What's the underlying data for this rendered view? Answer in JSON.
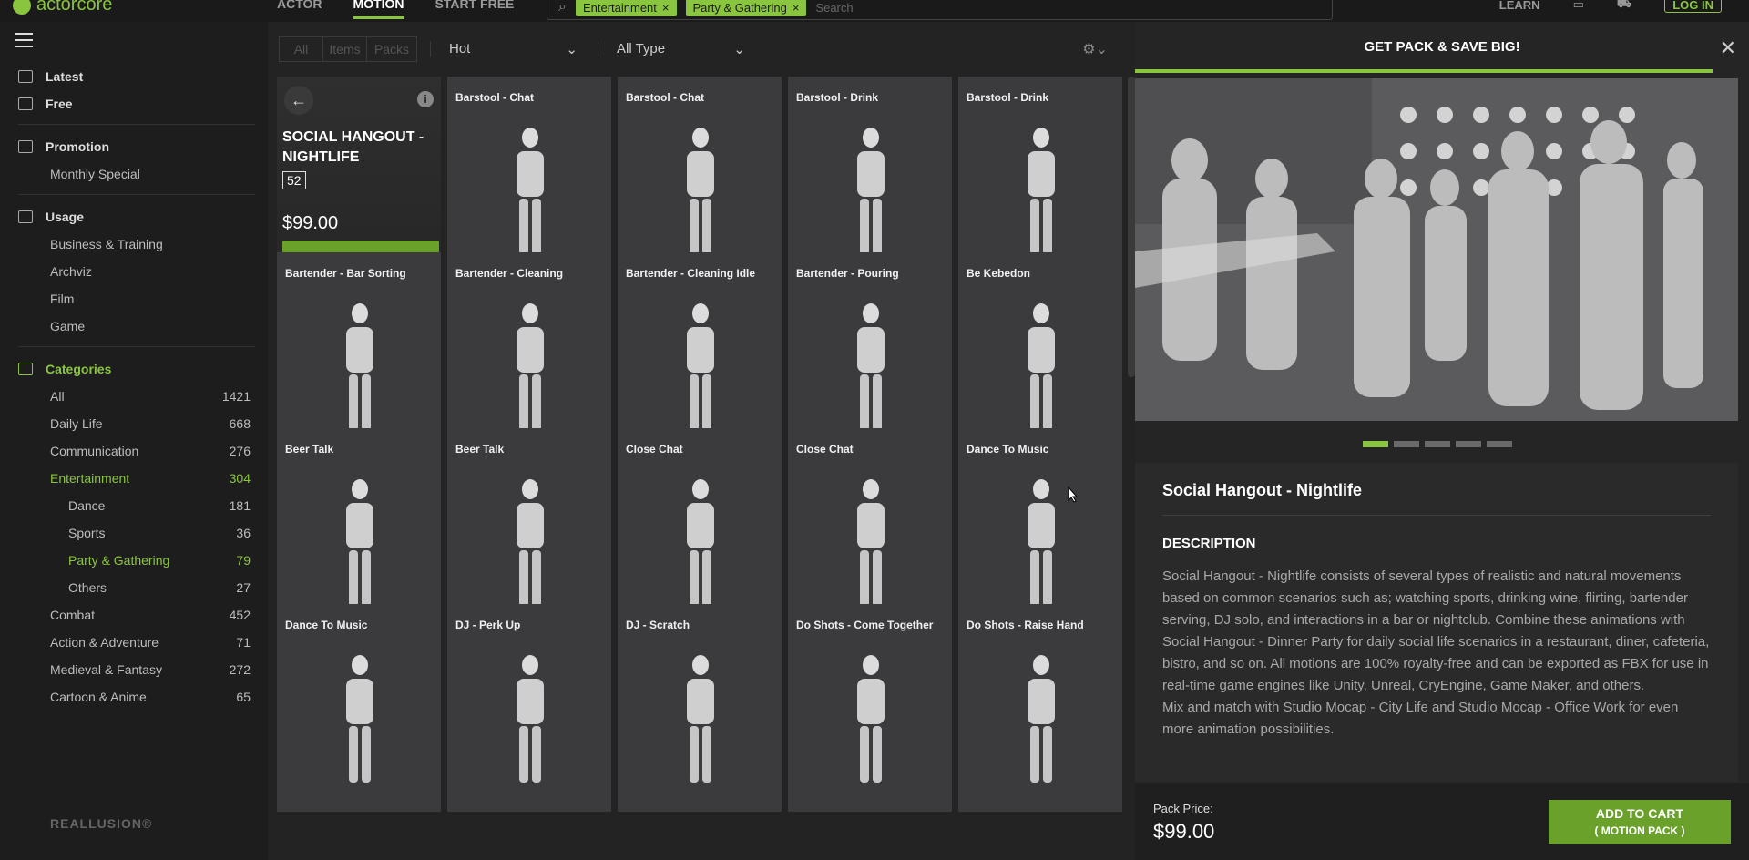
{
  "topbar": {
    "logo": "actorcore",
    "nav": [
      "ACTOR",
      "MOTION",
      "START FREE"
    ],
    "active_nav": "MOTION",
    "chips": [
      "Entertainment",
      "Party & Gathering"
    ],
    "search_placeholder": "Search",
    "learn": "LEARN",
    "login": "LOG IN"
  },
  "sidebar": {
    "latest": "Latest",
    "free": "Free",
    "promotion": "Promotion",
    "monthly_special": "Monthly Special",
    "usage": "Usage",
    "usage_items": [
      "Business & Training",
      "Archviz",
      "Film",
      "Game"
    ],
    "categories": "Categories",
    "cats": [
      {
        "label": "All",
        "count": "1421"
      },
      {
        "label": "Daily Life",
        "count": "668"
      },
      {
        "label": "Communication",
        "count": "276"
      },
      {
        "label": "Entertainment",
        "count": "304"
      },
      {
        "label": "Dance",
        "count": "181"
      },
      {
        "label": "Sports",
        "count": "36"
      },
      {
        "label": "Party & Gathering",
        "count": "79"
      },
      {
        "label": "Others",
        "count": "27"
      },
      {
        "label": "Combat",
        "count": "452"
      },
      {
        "label": "Action & Adventure",
        "count": "71"
      },
      {
        "label": "Medieval & Fantasy",
        "count": "272"
      },
      {
        "label": "Cartoon & Anime",
        "count": "65"
      }
    ],
    "brand": "REALLUSION®"
  },
  "filters": {
    "seg": [
      "All",
      "Items",
      "Packs"
    ],
    "sort": "Hot",
    "type": "All Type"
  },
  "pack": {
    "title": "SOCIAL HANGOUT - NIGHTLIFE",
    "count": "52",
    "price": "$99.00",
    "cart": "ADD TO CART"
  },
  "tiles": [
    "Barstool - Chat",
    "Barstool - Chat",
    "Barstool - Drink",
    "Barstool - Drink",
    "Bartender - Bar Sorting",
    "Bartender - Cleaning",
    "Bartender - Cleaning Idle",
    "Bartender - Pouring",
    "Be Kebedon",
    "Beer Talk",
    "Beer Talk",
    "Close Chat",
    "Close Chat",
    "Dance To Music",
    "Dance To Music",
    "DJ - Perk Up",
    "DJ - Scratch",
    "Do Shots - Come Together",
    "Do Shots - Raise Hand"
  ],
  "panel": {
    "header": "GET PACK & SAVE BIG!",
    "title": "Social Hangout - Nightlife",
    "desc_heading": "DESCRIPTION",
    "desc1": "Social Hangout - Nightlife consists of several types of realistic and natural movements based on common scenarios such as; watching sports, drinking wine, flirting, bartender serving, DJ solo, and interactions in a bar or nightclub. Combine these animations with Social Hangout - Dinner Party for daily social life scenarios in a restaurant, diner, cafeteria, bistro, and so on. All motions are 100% royalty-free and can be exported as FBX for use in real-time game engines like Unity, Unreal, CryEngine, Game Maker, and others.",
    "desc2": "Mix and match with Studio Mocap - City Life and Studio Mocap - Office Work for even more animation possibilities.",
    "pack_price_label": "Pack Price:",
    "pack_price": "$99.00",
    "cart_line1": "ADD TO CART",
    "cart_line2": "( MOTION PACK )"
  },
  "colors": {
    "accent": "#8ac53f"
  }
}
